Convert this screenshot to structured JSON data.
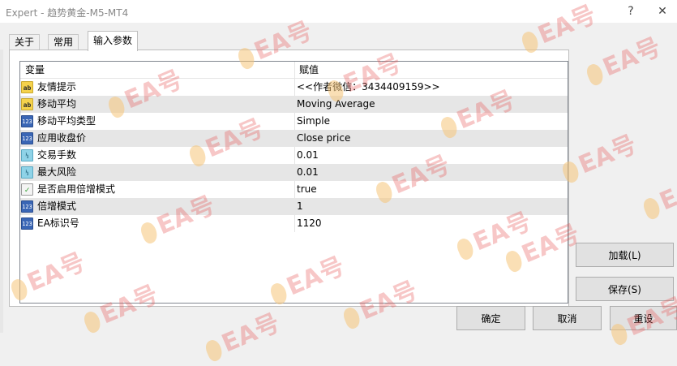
{
  "window": {
    "title": "Expert - 趋势黄金-M5-MT4",
    "help_label": "?",
    "close_label": "✕"
  },
  "tabs": [
    {
      "label": "关于"
    },
    {
      "label": "常用"
    },
    {
      "label": "输入参数"
    }
  ],
  "grid": {
    "header_variable": "变量",
    "header_value": "赋值",
    "rows": [
      {
        "icon": "ab",
        "name": "友情提示",
        "value": "<<作者微信：3434409159>>"
      },
      {
        "icon": "ab",
        "name": "移动平均",
        "value": "Moving Average"
      },
      {
        "icon": "123",
        "name": "移动平均类型",
        "value": "Simple"
      },
      {
        "icon": "123",
        "name": "应用收盘价",
        "value": "Close price"
      },
      {
        "icon": "v2",
        "name": "交易手数",
        "value": "0.01"
      },
      {
        "icon": "v2",
        "name": "最大风险",
        "value": "0.01"
      },
      {
        "icon": "bool",
        "name": "是否启用倍增模式",
        "value": "true"
      },
      {
        "icon": "123",
        "name": "倍增模式",
        "value": "1"
      },
      {
        "icon": "123",
        "name": "EA标识号",
        "value": "1120"
      }
    ]
  },
  "buttons": {
    "load": "加载(L)",
    "save": "保存(S)",
    "ok": "确定",
    "cancel": "取消",
    "reset": "重设"
  },
  "watermark": "EA号"
}
